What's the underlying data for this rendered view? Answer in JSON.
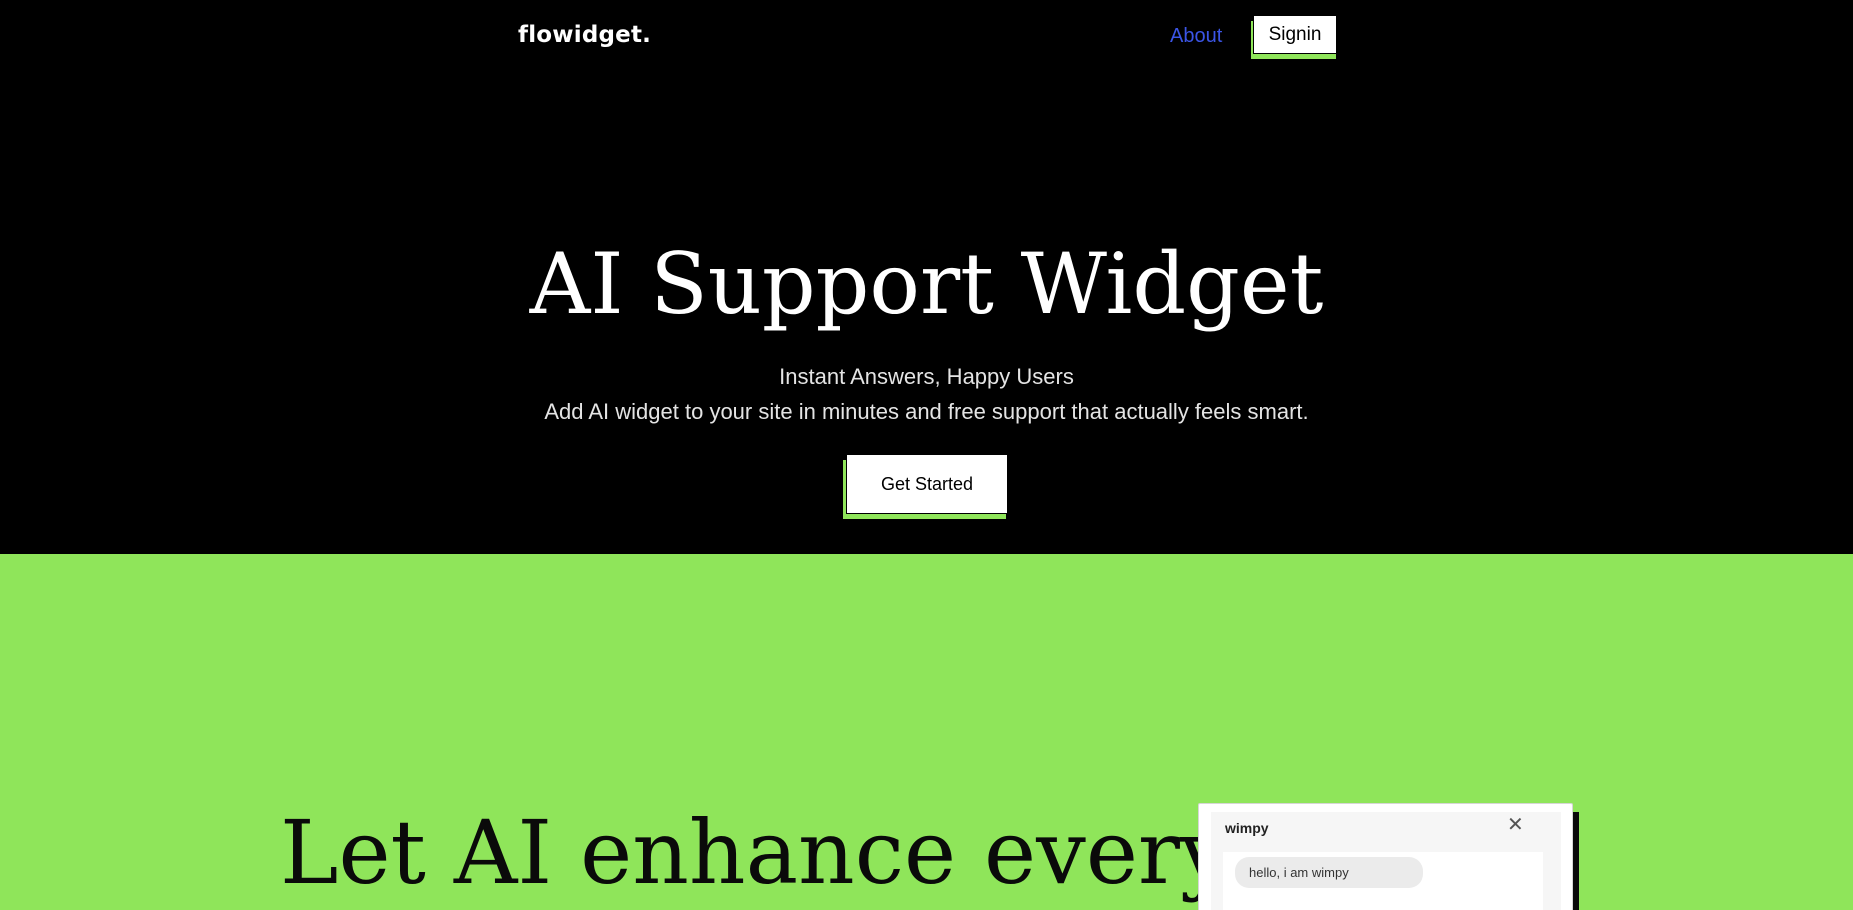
{
  "header": {
    "logo": "flowidget.",
    "nav_about": "About",
    "signin_label": "Signin"
  },
  "hero": {
    "title": "AI Support Widget",
    "subtitle": "Instant Answers, Happy Users",
    "description": "Add AI widget to your site in minutes and free support that actually feels smart.",
    "cta_label": "Get Started"
  },
  "features": {
    "title": "Let AI enhance every"
  },
  "widget": {
    "bot_name": "wimpy",
    "close_icon": "close-icon",
    "message": "hello, i am wimpy"
  },
  "colors": {
    "accent_green": "#8fe55a",
    "link_blue": "#3b55e6",
    "background_dark": "#000000"
  }
}
